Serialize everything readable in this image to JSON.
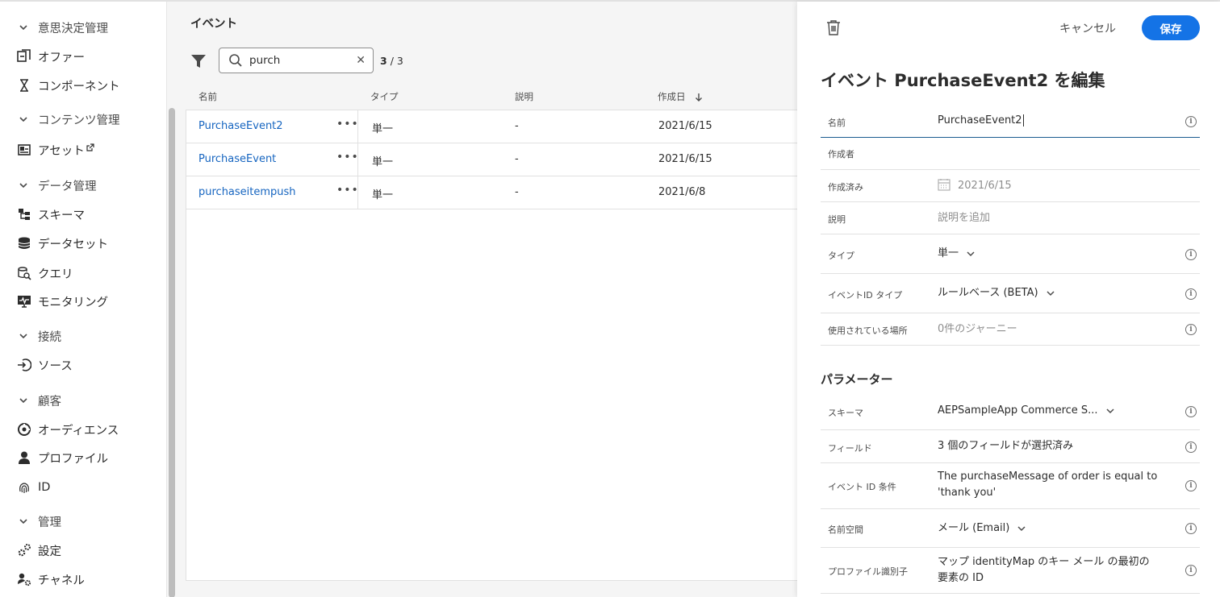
{
  "sidebar": {
    "sections": [
      {
        "label": "意思決定管理"
      },
      {
        "label": "コンテンツ管理"
      },
      {
        "label": "データ管理"
      },
      {
        "label": "接続"
      },
      {
        "label": "顧客"
      },
      {
        "label": "管理"
      }
    ],
    "items": [
      {
        "label": "オファー",
        "icon": "offers-icon"
      },
      {
        "label": "コンポーネント",
        "icon": "components-icon"
      },
      {
        "label": "アセット",
        "icon": "assets-icon"
      },
      {
        "label": "スキーマ",
        "icon": "schema-icon"
      },
      {
        "label": "データセット",
        "icon": "datasets-icon"
      },
      {
        "label": "クエリ",
        "icon": "queries-icon"
      },
      {
        "label": "モニタリング",
        "icon": "monitoring-icon"
      },
      {
        "label": "ソース",
        "icon": "sources-icon"
      },
      {
        "label": "オーディエンス",
        "icon": "audiences-icon"
      },
      {
        "label": "プロファイル",
        "icon": "profiles-icon"
      },
      {
        "label": "ID",
        "icon": "fingerprint-icon"
      },
      {
        "label": "設定",
        "icon": "settings-icon"
      },
      {
        "label": "チャネル",
        "icon": "channels-icon"
      }
    ]
  },
  "list": {
    "title": "イベント",
    "search": {
      "value": "purch"
    },
    "count_current": "3",
    "count_total": "/ 3",
    "columns": {
      "name": "名前",
      "type": "タイプ",
      "description": "説明",
      "created": "作成日"
    },
    "rows": [
      {
        "name": "PurchaseEvent2",
        "type": "単一",
        "description": "-",
        "created": "2021/6/15"
      },
      {
        "name": "PurchaseEvent",
        "type": "単一",
        "description": "-",
        "created": "2021/6/15"
      },
      {
        "name": "purchaseitempush",
        "type": "単一",
        "description": "-",
        "created": "2021/6/8"
      }
    ]
  },
  "panel": {
    "cancel_label": "キャンセル",
    "save_label": "保存",
    "title": "イベント PurchaseEvent2 を編集",
    "fields": {
      "name": {
        "label": "名前",
        "value": "PurchaseEvent2"
      },
      "author": {
        "label": "作成者",
        "value": ""
      },
      "created": {
        "label": "作成済み",
        "value": "2021/6/15"
      },
      "description": {
        "label": "説明",
        "placeholder": "説明を追加"
      },
      "type": {
        "label": "タイプ",
        "value": "単一"
      },
      "event_id_type": {
        "label": "イベントID タイプ",
        "value": "ルールベース (BETA)"
      },
      "used_in": {
        "label": "使用されている場所",
        "value": "0件のジャーニー"
      }
    },
    "params_title": "パラメーター",
    "params": {
      "schema": {
        "label": "スキーマ",
        "value": "AEPSampleApp Commerce S..."
      },
      "fields": {
        "label": "フィールド",
        "value": "3 個のフィールドが選択済み"
      },
      "event_id_condition": {
        "label": "イベント ID 条件",
        "value_line1": "The purchaseMessage of order is equal to",
        "value_line2": "'thank you'"
      },
      "namespace": {
        "label": "名前空間",
        "value": "メール (Email)"
      },
      "profile_identifier": {
        "label": "プロファイル識別子",
        "value_line1": "マップ identityMap のキー メール の最初の",
        "value_line2": "要素の ID"
      }
    }
  },
  "colors": {
    "accent": "#1473e6",
    "link": "#1665c0"
  }
}
